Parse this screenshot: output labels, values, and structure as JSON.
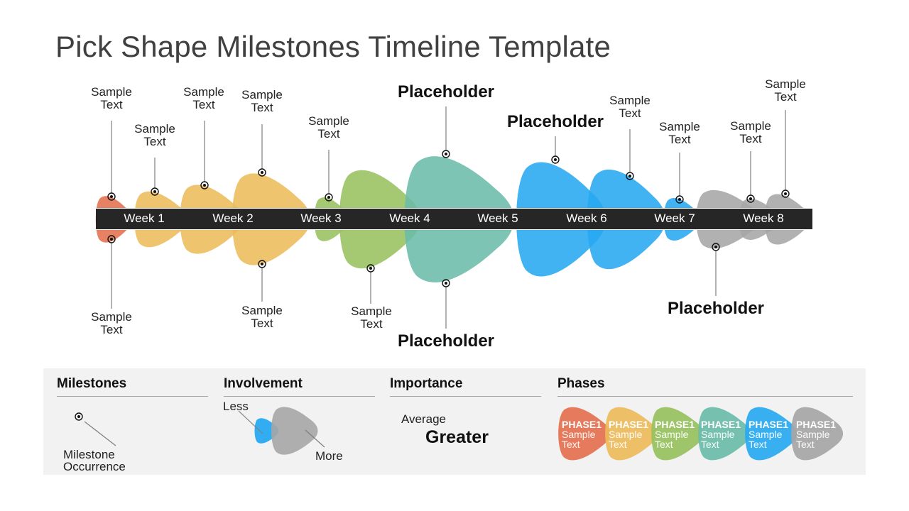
{
  "title": "Pick Shape Milestones Timeline Template",
  "colors": {
    "red": "#E4704F",
    "yellow": "#EDBC5B",
    "green": "#98C160",
    "teal": "#6BBCAA",
    "blue": "#27A9F1",
    "gray": "#A6A6A6",
    "bar": "#262626"
  },
  "weeks": [
    "Week 1",
    "Week 2",
    "Week 3",
    "Week 4",
    "Week 5",
    "Week 6",
    "Week 7",
    "Week 8"
  ],
  "milestones_top": [
    {
      "text1": "Sample",
      "text2": "Text"
    },
    {
      "text1": "Sample",
      "text2": "Text"
    },
    {
      "text1": "Sample",
      "text2": "Text"
    },
    {
      "text1": "Sample",
      "text2": "Text"
    },
    {
      "text1": "Sample",
      "text2": "Text"
    },
    {
      "text": "Placeholder"
    },
    {
      "text": "Placeholder"
    },
    {
      "text1": "Sample",
      "text2": "Text"
    },
    {
      "text1": "Sample",
      "text2": "Text"
    },
    {
      "text1": "Sample",
      "text2": "Text"
    },
    {
      "text1": "Sample",
      "text2": "Text"
    }
  ],
  "milestones_bottom": [
    {
      "text1": "Sample",
      "text2": "Text"
    },
    {
      "text1": "Sample",
      "text2": "Text"
    },
    {
      "text1": "Sample",
      "text2": "Text"
    },
    {
      "text": "Placeholder"
    },
    {
      "text": "Placeholder"
    }
  ],
  "legend": {
    "milestones": {
      "heading": "Milestones",
      "label1": "Milestone",
      "label2": "Occurrence"
    },
    "involvement": {
      "heading": "Involvement",
      "less": "Less",
      "more": "More"
    },
    "importance": {
      "heading": "Importance",
      "average": "Average",
      "greater": "Greater"
    },
    "phases": {
      "heading": "Phases",
      "items": [
        {
          "title": "PHASE1",
          "line1": "Sample",
          "line2": "Text",
          "color": "#E4704F"
        },
        {
          "title": "PHASE1",
          "line1": "Sample",
          "line2": "Text",
          "color": "#EDBC5B"
        },
        {
          "title": "PHASE1",
          "line1": "Sample",
          "line2": "Text",
          "color": "#98C160"
        },
        {
          "title": "PHASE1",
          "line1": "Sample",
          "line2": "Text",
          "color": "#6BBCAA"
        },
        {
          "title": "PHASE1",
          "line1": "Sample",
          "line2": "Text",
          "color": "#27A9F1"
        },
        {
          "title": "PHASE1",
          "line1": "Sample",
          "line2": "Text",
          "color": "#A6A6A6"
        }
      ]
    }
  }
}
